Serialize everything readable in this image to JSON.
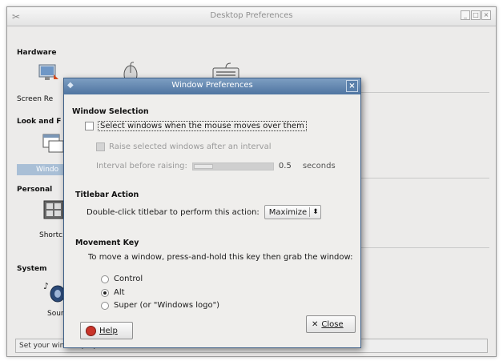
{
  "main_window": {
    "title": "Desktop Preferences",
    "categories": [
      {
        "label": "Hardware",
        "item_label": "Screen Re"
      },
      {
        "label": "Look and F",
        "item_label": "Windo"
      },
      {
        "label": "Personal",
        "item_label": "Shortc"
      },
      {
        "label": "System",
        "item_label": "Soun"
      }
    ],
    "status_text": "Set your window properties"
  },
  "dialog": {
    "title": "Window Preferences",
    "window_selection": {
      "heading": "Window Selection",
      "select_on_hover_label": "Select windows when the mouse moves over them",
      "select_on_hover_checked": false,
      "raise_label": "Raise selected windows after an interval",
      "raise_checked": false,
      "interval_label": "Interval before raising:",
      "interval_value": "0.5",
      "interval_unit": "seconds"
    },
    "titlebar_action": {
      "heading": "Titlebar Action",
      "label": "Double-click titlebar to perform this action:",
      "selected": "Maximize"
    },
    "movement_key": {
      "heading": "Movement Key",
      "instruction": "To move a window, press-and-hold this key then grab the window:",
      "options": [
        "Control",
        "Alt",
        "Super (or \"Windows logo\")"
      ],
      "selected": "Alt"
    },
    "help_label": "Help",
    "close_label": "Close"
  }
}
